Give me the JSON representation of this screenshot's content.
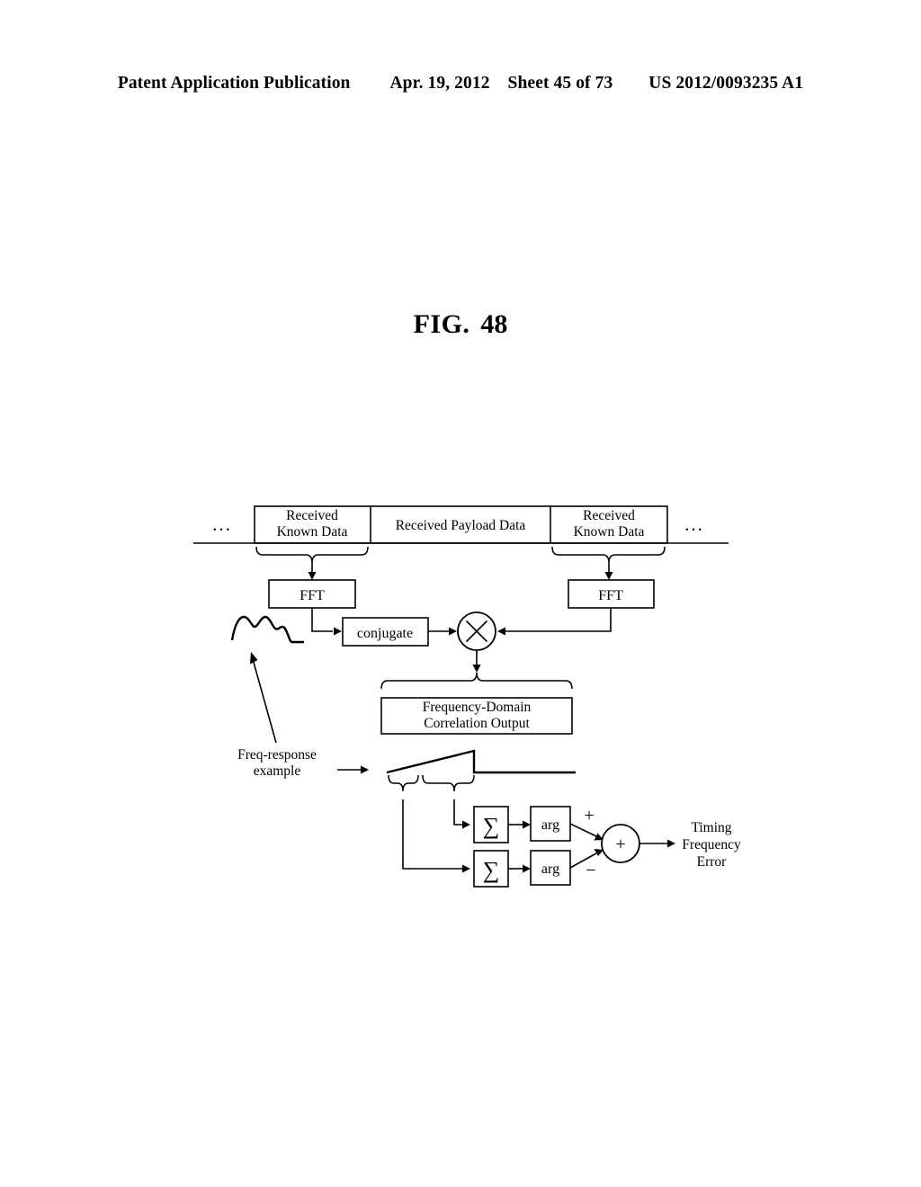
{
  "header": {
    "publication": "Patent Application Publication",
    "date": "Apr. 19, 2012",
    "sheet": "Sheet 45 of 73",
    "patent_number": "US 2012/0093235 A1"
  },
  "figure": {
    "label": "FIG.",
    "number": "48"
  },
  "diagram": {
    "ellipsis_left": "...",
    "ellipsis_right": "...",
    "frame_blocks": [
      {
        "line1": "Received",
        "line2": "Known Data"
      },
      {
        "line1": "Received Payload Data",
        "line2": ""
      },
      {
        "line1": "Received",
        "line2": "Known Data"
      }
    ],
    "fft_left": "FFT",
    "fft_right": "FFT",
    "conjugate": "conjugate",
    "multiplier_symbol": "✕",
    "correlation_output": {
      "line1": "Frequency-Domain",
      "line2": "Correlation Output"
    },
    "freq_response_note": {
      "line1": "Freq-response",
      "line2": "example"
    },
    "sum_upper": "∑",
    "sum_lower": "∑",
    "arg_upper": "arg",
    "arg_lower": "arg",
    "adder_symbol": "+",
    "sign_plus": "+",
    "sign_minus": "−",
    "output_label": {
      "line1": "Timing",
      "line2": "Frequency",
      "line3": "Error"
    }
  }
}
